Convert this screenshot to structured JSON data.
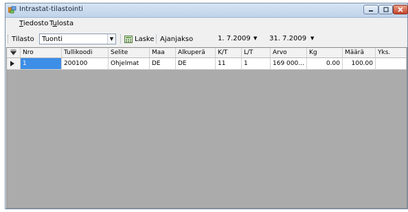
{
  "window": {
    "title": "Intrastat-tilastointi",
    "icon": "intrastat-app-icon"
  },
  "menu": [
    {
      "label_underlined": "T",
      "label_rest": "iedosto"
    },
    {
      "label_pre": "T",
      "label_underlined": "u",
      "label_rest": "losta"
    }
  ],
  "toolbar": {
    "tilasto_label": "Tilasto",
    "tilasto_value": "Tuonti",
    "laske_label": "Laske",
    "ajanjakso_label": "Ajanjakso",
    "date_from": "1. 7.2009",
    "date_to": "31. 7.2009"
  },
  "grid": {
    "columns": [
      "Nro",
      "Tullikoodi",
      "Selite",
      "Maa",
      "Alkuperä",
      "K/T",
      "L/T",
      "Arvo",
      "Kg",
      "Määrä",
      "Yks."
    ],
    "rows": [
      {
        "nro": "1",
        "tullikoodi": "200100",
        "selite": "Ohjelmat",
        "maa": "DE",
        "alkupera": "DE",
        "kt": "11",
        "lt": "1",
        "arvo": "169 000...",
        "kg": "0.00",
        "maara": "100.00",
        "yks": ""
      }
    ]
  },
  "colors": {
    "titlebar": "#bfd3ea",
    "selected_cell": "#3d8ee6",
    "grid_background": "#ababab"
  }
}
